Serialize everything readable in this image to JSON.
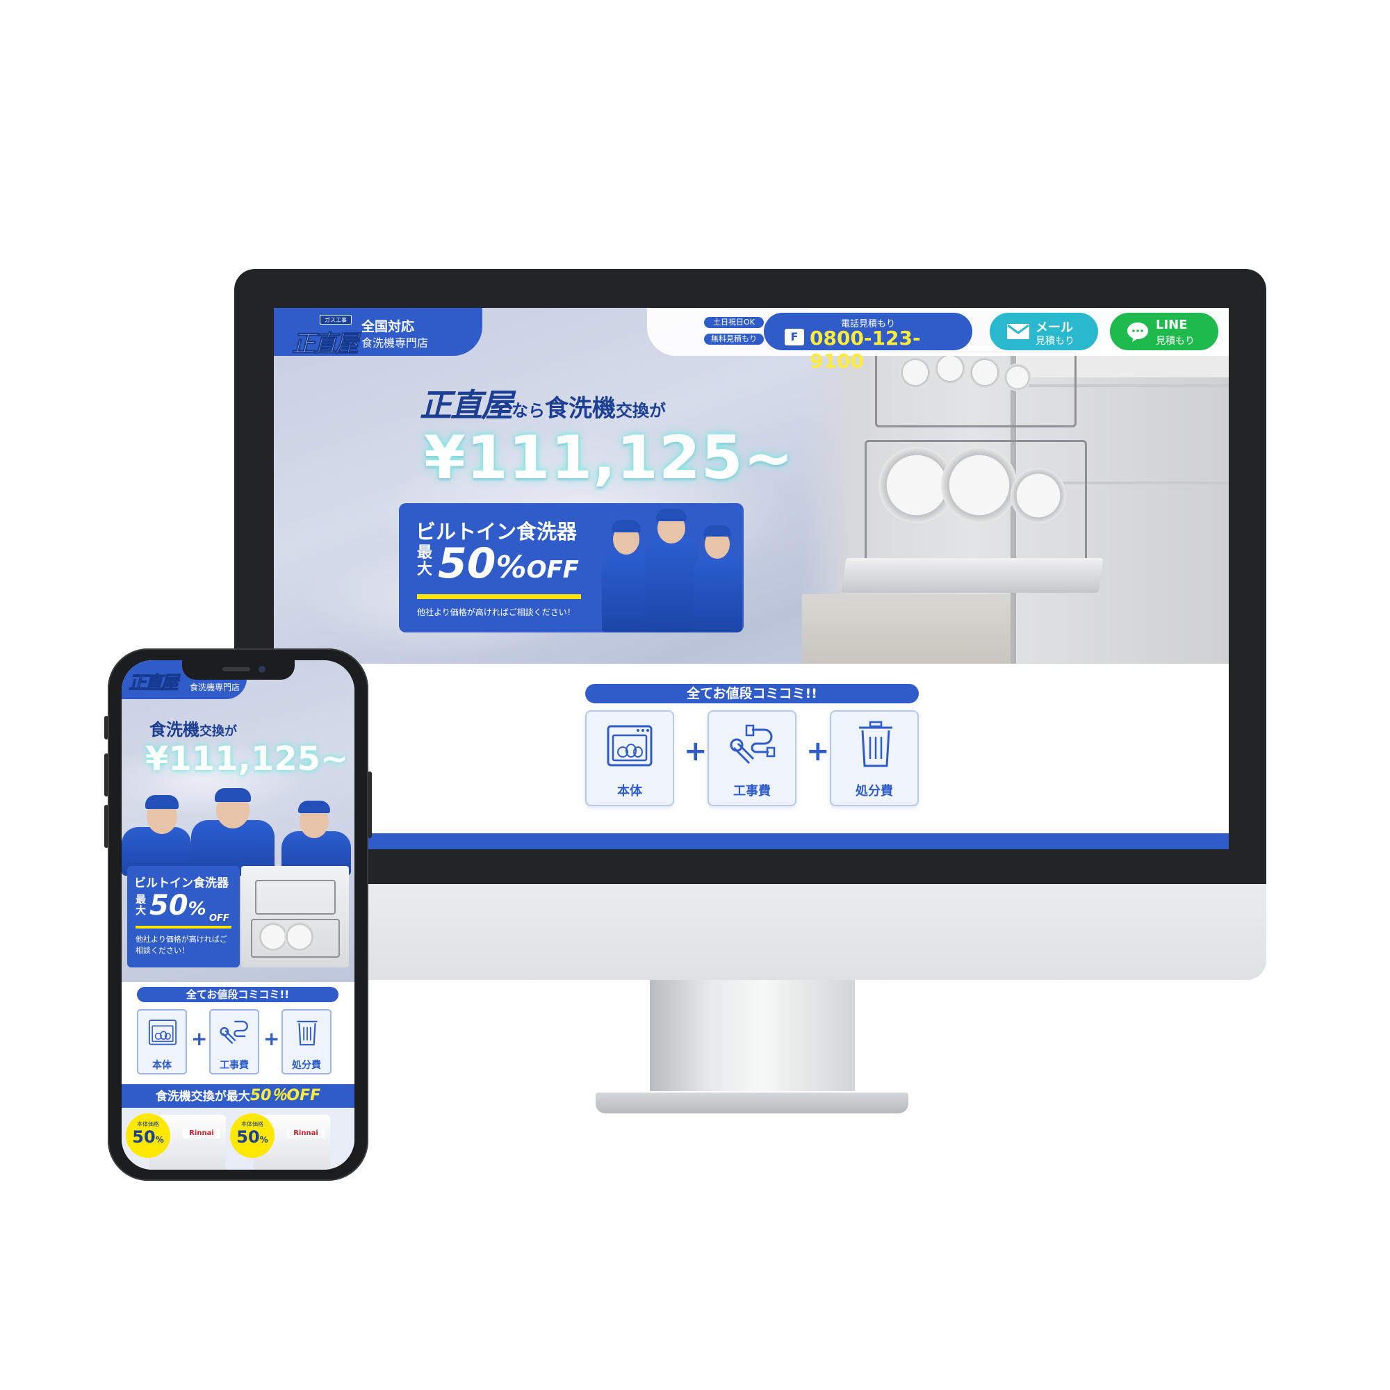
{
  "brand": {
    "logo_text": "正直屋",
    "logo_tag": "ガス工事",
    "primary_color": "#2f5cc8",
    "accent_yellow": "#ffec3a",
    "mail_color": "#2ab8cf",
    "line_color": "#1fba4d"
  },
  "desktop": {
    "header": {
      "title": "全国対応",
      "subtitle": "食洗機専門店",
      "badge_weekend": "土日祝日OK",
      "badge_free": "無料見積もり",
      "phone_label": "電話見積もり",
      "freecall_icon": "F",
      "phone_number": "0800-123-9100",
      "mail_main": "メール",
      "mail_sub": "見積もり",
      "line_main": "LINE",
      "line_sub": "見積もり"
    },
    "hero": {
      "catch_brand": "正直屋",
      "catch_a": "なら",
      "catch_b": "食洗機",
      "catch_c": "交換",
      "catch_d": "が",
      "price": "¥111,125~",
      "promo_title": "ビルトイン食洗器",
      "promo_saidai": "最大",
      "promo_number": "50",
      "promo_percent": "%",
      "promo_off": "OFF",
      "promo_note": "他社より価格が高ければご相談ください！"
    },
    "included": {
      "heading": "全てお値段コミコミ!!",
      "items": [
        "本体",
        "工事費",
        "処分費"
      ],
      "plus": "+"
    }
  },
  "mobile": {
    "header": {
      "subtitle": "食洗機専門店"
    },
    "hero": {
      "catch_a": "食洗機",
      "catch_b": "交換",
      "catch_c": "が",
      "price": "¥111,125~",
      "promo_title": "ビルトイン食洗器",
      "promo_saidai": "最大",
      "promo_number": "50",
      "promo_percent": "%",
      "promo_off": "OFF",
      "promo_note": "他社より価格が高ければご相談ください！"
    },
    "included": {
      "heading": "全てお値段コミコミ!!",
      "items": [
        "本体",
        "工事費",
        "処分費"
      ],
      "plus": "+"
    },
    "band": {
      "text": "食洗機交換が最大",
      "highlight": "50％OFF"
    },
    "products": {
      "badge_label": "本体価格",
      "badge_value": "50",
      "badge_unit": "%",
      "maker": "Rinnai"
    }
  }
}
